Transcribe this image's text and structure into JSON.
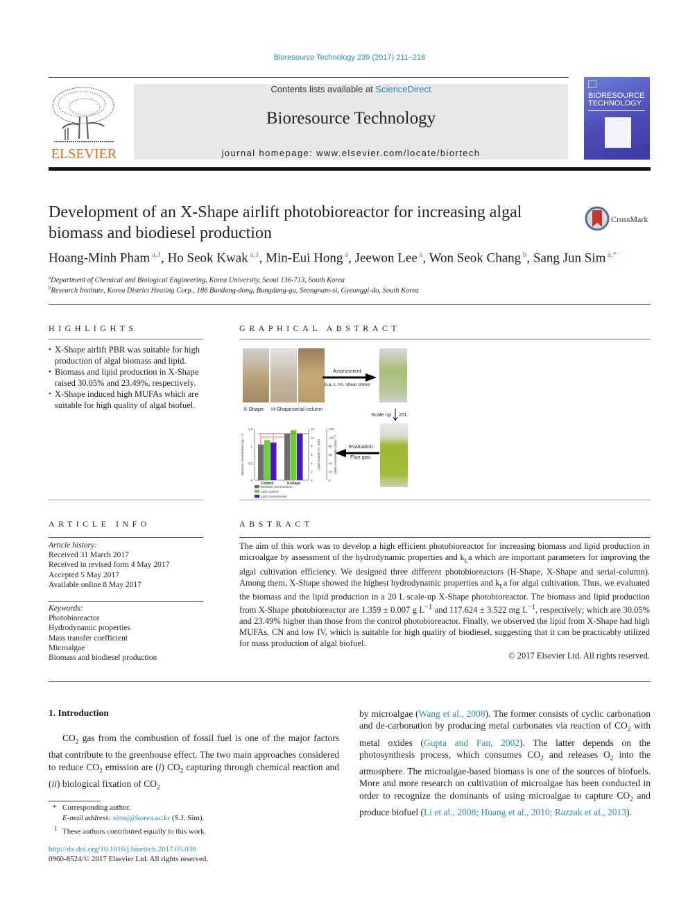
{
  "header": {
    "citation": "Bioresource Technology 239 (2017) 211–218",
    "contents_prefix": "Contents lists available at ",
    "contents_link": "ScienceDirect",
    "journal_title": "Bioresource Technology",
    "homepage": "journal homepage: www.elsevier.com/locate/biortech",
    "publisher_logo": "ELSEVIER",
    "cover_title_1": "BIORESOURCE",
    "cover_title_2": "TECHNOLOGY"
  },
  "article": {
    "title": "Development of an X-Shape airlift photobioreactor for increasing algal biomass and biodiesel production",
    "crossmark": "CrossMark",
    "authors": [
      {
        "name": "Hoang-Minh Pham",
        "sup": "a,1"
      },
      {
        "name": "Ho Seok Kwak",
        "sup": "a,1"
      },
      {
        "name": "Min-Eui Hong",
        "sup": "a"
      },
      {
        "name": "Jeewon Lee",
        "sup": "a"
      },
      {
        "name": "Won Seok Chang",
        "sup": "b"
      },
      {
        "name": "Sang Jun Sim",
        "sup": "a,*"
      }
    ],
    "affiliations": [
      {
        "mark": "a",
        "text": "Department of Chemical and Biological Engineering, Korea University, Seoul 136-713, South Korea"
      },
      {
        "mark": "b",
        "text": "Research Institute, Korea District Heating Corp., 186 Bundang-dong, Bungdang-gu, Seongnam-si, Gyeonggi-do, South Korea"
      }
    ]
  },
  "highlights": {
    "heading": "HIGHLIGHTS",
    "items": [
      "X-Shape airlift PBR was suitable for high production of algal biomass and lipid.",
      "Biomass and lipid production in X-Shape raised 30.05% and 23.49%, respectively.",
      "X-Shape induced high MUFAs which are suitable for high quality of algal biofuel."
    ]
  },
  "graphical_abstract": {
    "heading": "GRAPHICAL ABSTRACT",
    "photo_labels": [
      "X-Shape",
      "H-Shape",
      "serial-column"
    ],
    "arrow_assessment": "Assessment",
    "arrow_assessment_sub": "kLa, ε, tm, shear stress",
    "scale_up": "Scale up",
    "scale_up_volume": "20L",
    "arrow_evaluation": "Evaluation",
    "arrow_evaluation_sub": "Flue gas",
    "chart": {
      "categories": [
        "Control",
        "X-shape"
      ],
      "series": [
        {
          "name": "Biomass concentration",
          "color": "#6d6d6d",
          "values": [
            1.04,
            1.36
          ]
        },
        {
          "name": "Lipid content",
          "color": "#6ad13a",
          "values": [
            1.17,
            1.46
          ]
        },
        {
          "name": "Lipid concentration",
          "color": "#4a18b8",
          "values": [
            1.1,
            1.36
          ]
        }
      ],
      "annotations": [
        "30.05%",
        "23.49%"
      ],
      "left_axis": {
        "label": "Biomass concentration (g L⁻¹)",
        "ticks": [
          "0",
          "0.5",
          "1",
          "1.5"
        ]
      },
      "mid_axis": {
        "label": "Lipid content (%, w/w)",
        "ticks": [
          "0",
          "2",
          "4",
          "6",
          "8",
          "10",
          "12"
        ]
      },
      "right_axis": {
        "label": "Lipid concentration (mg L⁻¹)",
        "ticks": [
          "0",
          "20",
          "40",
          "60",
          "80",
          "100",
          "120"
        ]
      }
    }
  },
  "article_info": {
    "heading": "ARTICLE INFO",
    "history_label": "Article history:",
    "history": [
      "Received 31 March 2017",
      "Received in revised form 4 May 2017",
      "Accepted 5 May 2017",
      "Available online 8 May 2017"
    ],
    "keywords_label": "Keywords:",
    "keywords": [
      "Photobioreactor",
      "Hydrodynamic properties",
      "Mass transfer coefficient",
      "Microalgae",
      "Biomass and biodiesel production"
    ]
  },
  "abstract": {
    "heading": "ABSTRACT",
    "text_1": "The aim of this work was to develop a high efficient photobioreactor for increasing biomass and lipid production in microalgae by assessment of the hydrodynamic properties and k",
    "text_2": "a which are important parameters for improving the algal cultivation efficiency. We designed three different photobioreactors (H-Shape, X-Shape and serial-column). Among them, X-Shape showed the highest hydrodynamic properties and k",
    "text_3": "a for algal cultivation. Thus, we evaluated the biomass and the lipid production in a 20 L scale-up X-Shape photobioreactor. The biomass and lipid production from X-Shape photobioreactor are 1.359 ± 0.007 g L",
    "text_4": " and 117.624 ± 3.522 mg L",
    "text_5": ", respectively; which are 30.05% and 23.49% higher than those from the control photobioreactor. Finally, we observed the lipid from X-Shape had high MUFAs, CN and low IV, which is suitable for high quality of biodiesel, suggesting that it can be practicably utilized for mass production of algal biofuel.",
    "sub_L": "L",
    "sup_minus1": "−1",
    "copyright": "© 2017 Elsevier Ltd. All rights reserved."
  },
  "introduction": {
    "heading": "1. Introduction",
    "left": {
      "p1": "gas from the combustion of fossil fuel is one of the major factors that contribute to the greenhouse effect. The two main approaches considered to reduce CO",
      "p2": " emission are (",
      "i": "i",
      "p3": ") CO",
      "p4": " capturing through chemical reaction and (",
      "ii": "ii",
      "p5": ") biological fixation of CO",
      "co": "CO",
      "two": "2"
    },
    "right": {
      "t1": "by microalgae (",
      "ref1": "Wang et al., 2008",
      "t2": "). The former consists of cyclic carbonation and de-carbonation by producing metal carbonates via reaction of CO",
      "t3": " with metal oxides (",
      "ref2": "Gupta and Fan, 2002",
      "t4": "). The latter depends on the photosynthesis process, which consumes CO",
      "t5": " and releases O",
      "t6": " into the atmosphere. The microalgae-based biomass is one of the sources of biofuels. More and more research on cultivation of microalgae has been conducted in order to recognize the dominants of using microalgae to capture CO",
      "t7": " and produce biofuel (",
      "ref3": "Li et al., 2008; Huang et al., 2010; Razzak et al., 2013",
      "t8": ")."
    }
  },
  "footnotes": {
    "star": "*",
    "corresponding": "Corresponding author.",
    "email_label": "E-mail address:",
    "email": "simsj@korea.ac.kr",
    "email_suffix": "(S.J. Sim).",
    "one": "1",
    "equal": "These authors contributed equally to this work.",
    "doi": "http://dx.doi.org/10.1016/j.biortech.2017.05.030",
    "issn": "0960-8524/© 2017 Elsevier Ltd. All rights reserved."
  }
}
